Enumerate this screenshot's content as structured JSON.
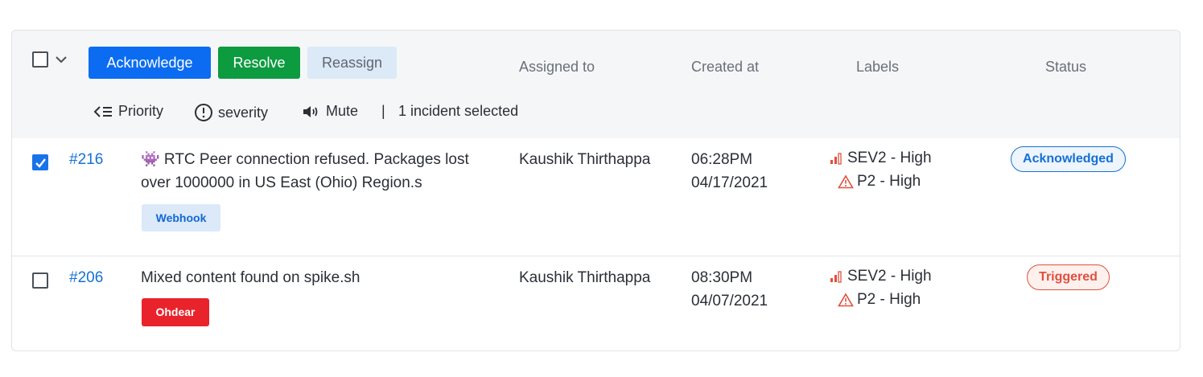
{
  "toolbar": {
    "acknowledge_label": "Acknowledge",
    "resolve_label": "Resolve",
    "reassign_label": "Reassign",
    "priority_label": "Priority",
    "severity_label": "severity",
    "mute_label": "Mute",
    "separator": "|",
    "selection_text": "1 incident selected"
  },
  "columns": {
    "assigned_to": "Assigned to",
    "created_at": "Created at",
    "labels": "Labels",
    "status": "Status"
  },
  "incidents": [
    {
      "selected": true,
      "id": "#216",
      "title_line1": "👾 RTC Peer connection refused. Packages lost",
      "title_line2": "over 1000000 in US East (Ohio) Region.s",
      "source": "Webhook",
      "assignee": "Kaushik Thirthappa",
      "time": "06:28PM",
      "date": "04/17/2021",
      "severity_label": "SEV2 - High",
      "priority_label": "P2 - High",
      "status": "Acknowledged"
    },
    {
      "selected": false,
      "id": "#206",
      "title_line1": "Mixed content found on spike.sh",
      "title_line2": "",
      "source": "Ohdear",
      "assignee": "Kaushik Thirthappa",
      "time": "08:30PM",
      "date": "04/07/2021",
      "severity_label": "SEV2 - High",
      "priority_label": "P2 - High",
      "status": "Triggered"
    }
  ],
  "colors": {
    "acknowledge": "#0b6cf2",
    "resolve": "#0d9b40",
    "reassign_bg": "#dce9f7",
    "link": "#1570d6",
    "triggered": "#e0503e",
    "ohdear_tag": "#e8232b"
  },
  "icons": {
    "select_all": "checkbox-icon",
    "select_menu": "chevron-down-icon",
    "priority": "priority-list-icon",
    "severity": "alert-circle-icon",
    "mute": "speaker-icon",
    "severity_level": "signal-bars-icon",
    "priority_level": "warning-triangle-icon"
  }
}
